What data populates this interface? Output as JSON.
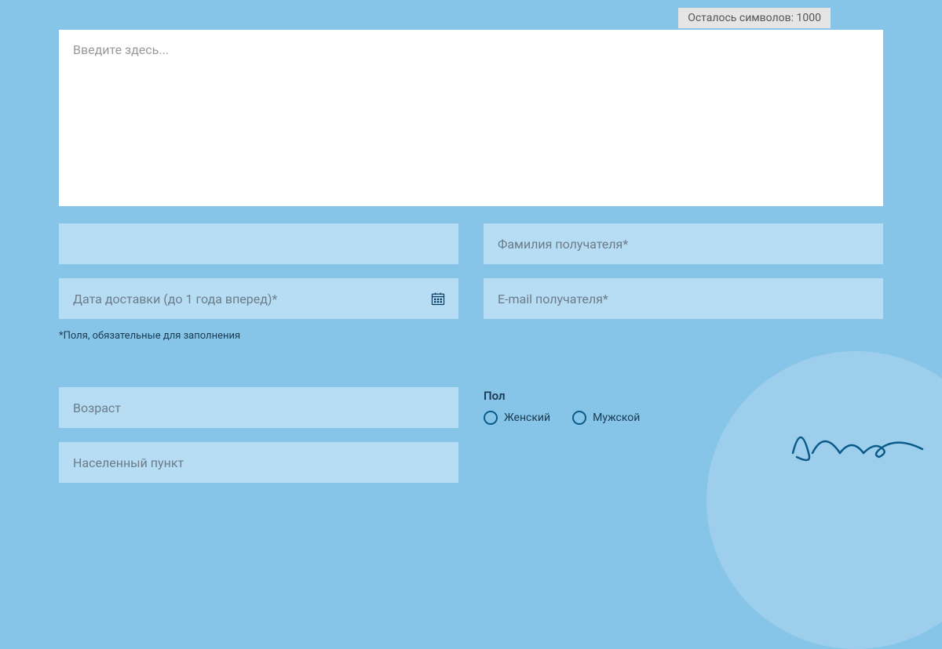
{
  "char_counter": {
    "label": "Осталось символов:",
    "count": "1000"
  },
  "form": {
    "message_placeholder": "Введите здесь...",
    "first_name_placeholder": "",
    "last_name_placeholder": "Фамилия получателя*",
    "delivery_date_placeholder": "Дата доставки (до 1 года вперед)*",
    "email_placeholder": "E-mail получателя*",
    "required_note": "*Поля, обязательные для заполнения",
    "age_placeholder": "Возраст",
    "location_placeholder": "Населенный пункт",
    "gender_label": "Пол",
    "gender_female": "Женский",
    "gender_male": "Мужской"
  }
}
